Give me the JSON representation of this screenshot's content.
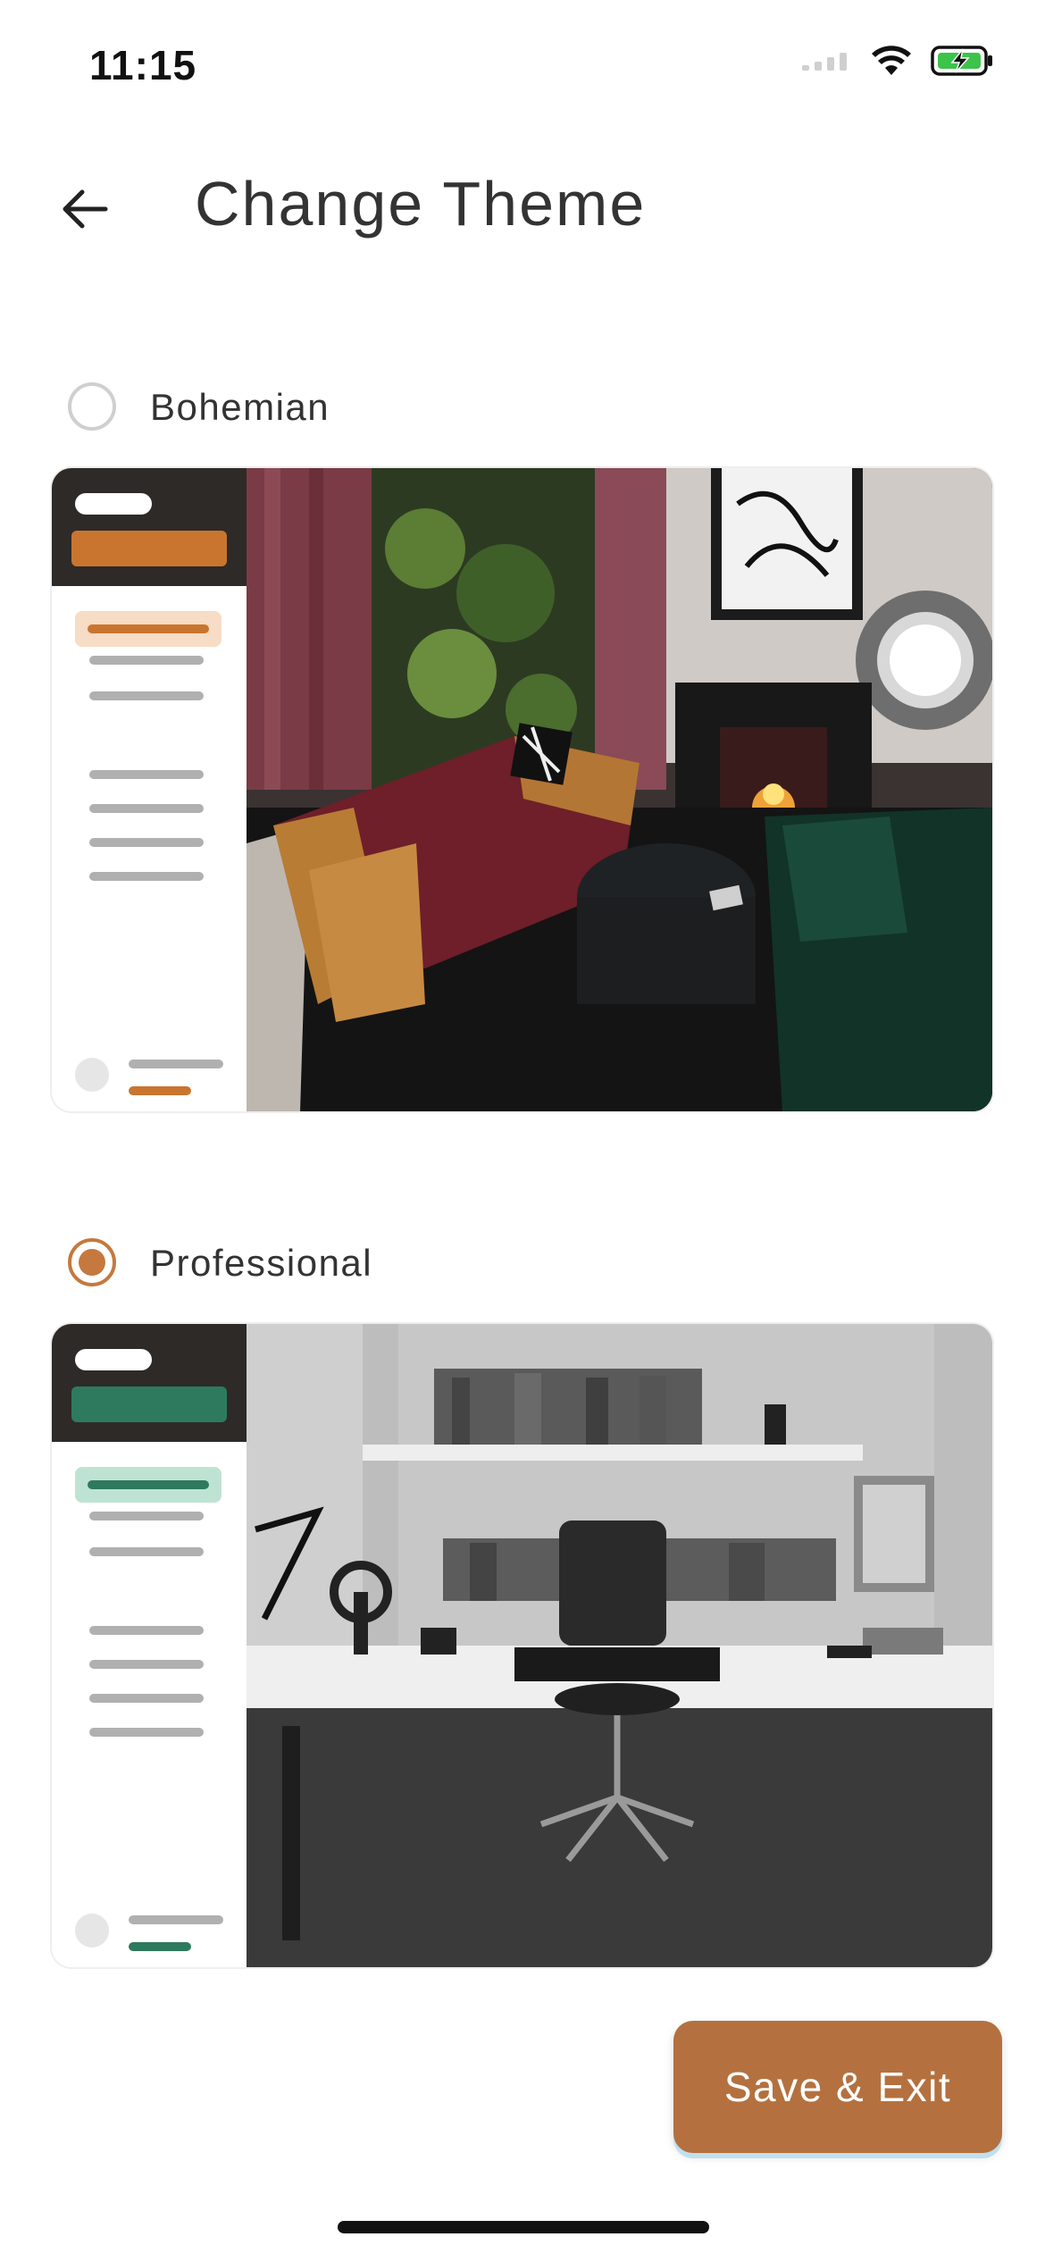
{
  "status_bar": {
    "time": "11:15",
    "battery_state": "charging"
  },
  "header": {
    "title": "Change Theme",
    "back_icon": "arrow-left-icon"
  },
  "themes": [
    {
      "label": "Bohemian",
      "selected": false,
      "accent_color": "#c97530",
      "accent_light": "#f7dcc6",
      "image_icon": "bohemian-living-room-photo"
    },
    {
      "label": "Professional",
      "selected": true,
      "accent_color": "#2e7a5e",
      "accent_light": "#bfe3d3",
      "image_icon": "professional-home-office-photo"
    }
  ],
  "actions": {
    "save_label": "Save & Exit"
  },
  "colors": {
    "primary": "#b4713f",
    "radio_selected": "#c5793f",
    "radio_unselected": "#cfcfcf"
  }
}
